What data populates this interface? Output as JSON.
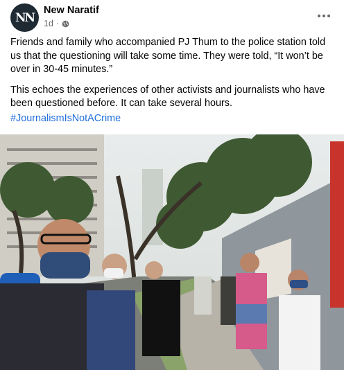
{
  "post": {
    "author": {
      "name": "New Naratif",
      "avatar_text": "NN"
    },
    "timestamp": "1d",
    "separator": "·",
    "privacy_icon": "globe-icon",
    "more_icon": "more-horizontal-icon",
    "paragraphs": [
      "Friends and family who accompanied PJ Thum to the police station told us that the questioning will take some time. They were told, “It won’t be over in 30-45 minutes.”",
      "This echoes the experiences of other activists and journalists who have been questioned before. It can take several hours."
    ],
    "hashtag": "#JournalismIsNotACrime",
    "photo": {
      "subject": "group-photo"
    }
  },
  "colors": {
    "text_primary": "#050505",
    "text_secondary": "#65676b",
    "link": "#216fdb",
    "avatar_bg": "#1f2a33"
  }
}
